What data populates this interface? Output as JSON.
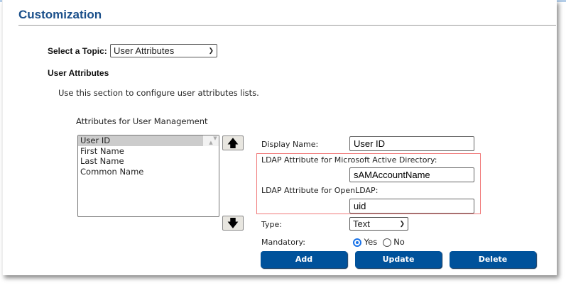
{
  "page": {
    "title": "Customization"
  },
  "topic": {
    "label": "Select a Topic:",
    "value": "User Attributes"
  },
  "section": {
    "heading": "User Attributes",
    "description": "Use this section to configure user attributes lists."
  },
  "list": {
    "label": "Attributes for User Management",
    "items": [
      "User ID",
      "First Name",
      "Last Name",
      "Common Name"
    ],
    "selected": "User ID"
  },
  "form": {
    "display_name_label": "Display Name:",
    "display_name_value": "User ID",
    "ad_label": "LDAP Attribute for Microsoft Active Directory:",
    "ad_value": "sAMAccountName",
    "openldap_label": "LDAP Attribute for OpenLDAP:",
    "openldap_value": "uid",
    "type_label": "Type:",
    "type_value": "Text",
    "mandatory_label": "Mandatory:",
    "yes": "Yes",
    "no": "No",
    "mandatory_selected": "Yes"
  },
  "buttons": {
    "add": "Add",
    "update": "Update",
    "delete": "Delete"
  },
  "icons": {
    "up": "arrow-up-icon",
    "down": "arrow-down-icon"
  },
  "colors": {
    "accent": "#00529b",
    "title": "#1a4f8a",
    "highlight_border": "#f07878"
  }
}
